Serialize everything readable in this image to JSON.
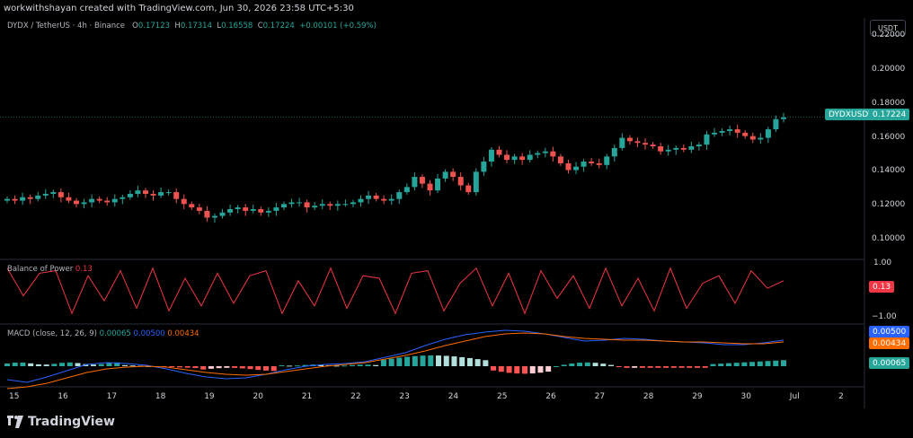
{
  "header": {
    "attribution": "workwithshayan created with TradingView.com, Jun 30, 2026 23:58 UTC+5:30",
    "currency_button": "USDT"
  },
  "legend": {
    "symbol": "DYDX / TetherUS · 4h · Binance",
    "open_label": "O",
    "open": "0.17123",
    "high_label": "H",
    "high": "0.17314",
    "low_label": "L",
    "low": "0.16558",
    "close_label": "C",
    "close": "0.17224",
    "change": "+0.00101 (+0.59%)"
  },
  "price_axis": {
    "ticks": [
      "0.22000",
      "0.20000",
      "0.18000",
      "0.16000",
      "0.14000",
      "0.12000",
      "0.10000"
    ],
    "last_symbol": "DYDXUSDT",
    "last_price": "0.17224"
  },
  "bop": {
    "title": "Balance of Power",
    "value": "0.13",
    "axis_top": "1.00",
    "axis_bottom": "−1.00"
  },
  "macd": {
    "title": "MACD (close, 12, 26, 9)",
    "hist_value": "0.00065",
    "macd_value": "0.00500",
    "signal_value": "0.00434"
  },
  "time_axis": {
    "labels": [
      "15",
      "16",
      "17",
      "18",
      "19",
      "20",
      "21",
      "22",
      "23",
      "24",
      "25",
      "26",
      "27",
      "28",
      "29",
      "30",
      "Jul",
      "2"
    ]
  },
  "footer": {
    "brand": "TradingView"
  },
  "colors": {
    "up": "#26a69a",
    "down": "#ef5350",
    "bop_line": "#f23645",
    "macd_line": "#2962ff",
    "signal_line": "#ff6d00",
    "hist_up_strong": "#26a69a",
    "hist_up_weak": "#b2dfdb",
    "hist_down_strong": "#ff5252",
    "hist_down_weak": "#ffcdd2"
  },
  "chart_data": {
    "type": "candlestick",
    "panes": [
      "price",
      "balance_of_power",
      "macd"
    ],
    "price_axis_range": [
      0.09,
      0.22
    ],
    "last_price": 0.17224,
    "closes": [
      0.124,
      0.123,
      0.125,
      0.124,
      0.126,
      0.127,
      0.128,
      0.125,
      0.123,
      0.121,
      0.122,
      0.124,
      0.123,
      0.122,
      0.124,
      0.125,
      0.127,
      0.129,
      0.127,
      0.126,
      0.128,
      0.128,
      0.124,
      0.121,
      0.119,
      0.117,
      0.113,
      0.114,
      0.116,
      0.118,
      0.119,
      0.117,
      0.118,
      0.116,
      0.117,
      0.119,
      0.121,
      0.122,
      0.122,
      0.119,
      0.12,
      0.121,
      0.12,
      0.121,
      0.121,
      0.122,
      0.124,
      0.126,
      0.124,
      0.123,
      0.124,
      0.128,
      0.131,
      0.137,
      0.133,
      0.129,
      0.136,
      0.14,
      0.137,
      0.132,
      0.128,
      0.14,
      0.146,
      0.153,
      0.15,
      0.147,
      0.149,
      0.147,
      0.15,
      0.151,
      0.152,
      0.149,
      0.145,
      0.141,
      0.143,
      0.146,
      0.145,
      0.144,
      0.149,
      0.154,
      0.16,
      0.158,
      0.157,
      0.156,
      0.155,
      0.152,
      0.153,
      0.154,
      0.153,
      0.155,
      0.156,
      0.162,
      0.163,
      0.164,
      0.165,
      0.163,
      0.161,
      0.159,
      0.16,
      0.165,
      0.171,
      0.172
    ],
    "macd_histogram_trend": "positive → negative → strongly positive (23–25) → negative (26) → near zero → positive",
    "time_labels": [
      "15",
      "16",
      "17",
      "18",
      "19",
      "20",
      "21",
      "22",
      "23",
      "24",
      "25",
      "26",
      "27",
      "28",
      "29",
      "30",
      "Jul",
      "2"
    ]
  }
}
